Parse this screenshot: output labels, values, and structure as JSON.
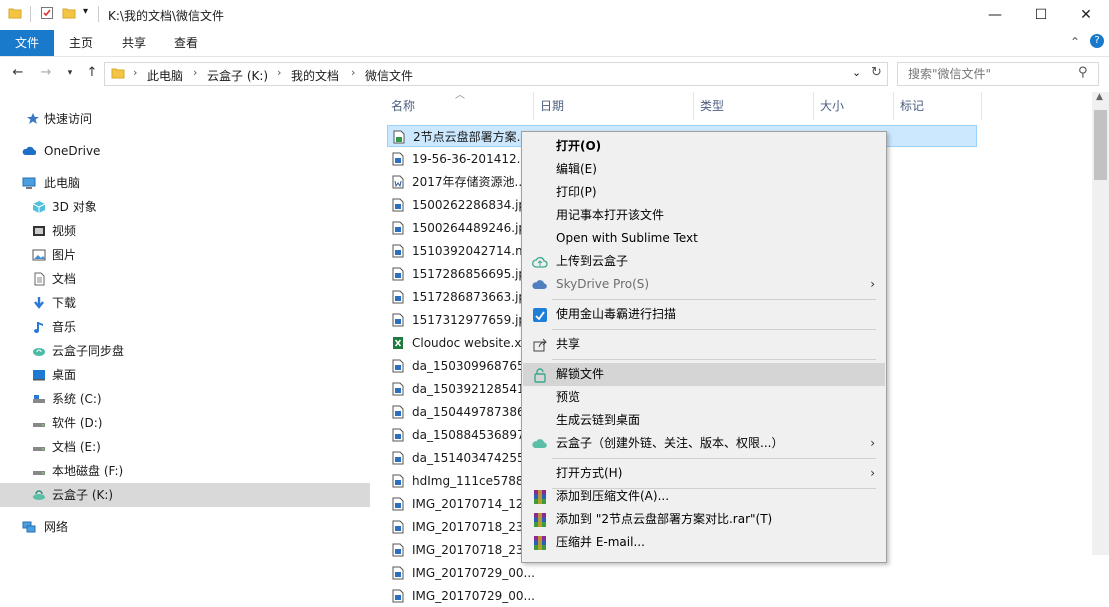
{
  "window": {
    "title": "K:\\我的文档\\微信文件",
    "minimize": "—",
    "maximize": "☐",
    "close": "✕"
  },
  "ribbon": {
    "tabs": [
      "文件",
      "主页",
      "共享",
      "查看"
    ],
    "collapse": "⌃",
    "help": "?"
  },
  "address": {
    "crumbs": [
      "此电脑",
      "云盒子 (K:)",
      "我的文档",
      "微信文件"
    ],
    "search_placeholder": "搜索\"微信文件\""
  },
  "nav": {
    "items": [
      {
        "label": "快速访问",
        "icon": "star-icon"
      },
      {
        "label": "OneDrive",
        "icon": "onedrive-cloud-icon"
      },
      {
        "label": "此电脑",
        "icon": "computer-icon"
      },
      {
        "label": "3D 对象",
        "icon": "3d-objects-icon"
      },
      {
        "label": "视频",
        "icon": "video-icon"
      },
      {
        "label": "图片",
        "icon": "pictures-icon"
      },
      {
        "label": "文档",
        "icon": "documents-icon"
      },
      {
        "label": "下载",
        "icon": "download-icon"
      },
      {
        "label": "音乐",
        "icon": "music-icon"
      },
      {
        "label": "云盒子同步盘",
        "icon": "sync-drive-icon"
      },
      {
        "label": "桌面",
        "icon": "desktop-icon"
      },
      {
        "label": "系统 (C:)",
        "icon": "drive-c-icon"
      },
      {
        "label": "软件 (D:)",
        "icon": "drive-icon"
      },
      {
        "label": "文档 (E:)",
        "icon": "drive-icon"
      },
      {
        "label": "本地磁盘 (F:)",
        "icon": "drive-icon"
      },
      {
        "label": "云盒子 (K:)",
        "icon": "cloud-drive-icon"
      },
      {
        "label": "网络",
        "icon": "network-icon"
      }
    ]
  },
  "columns": [
    "名称",
    "日期",
    "类型",
    "大小",
    "标记"
  ],
  "files": [
    {
      "name": "2节点云盘部署方案...",
      "icon": "locked-doc-icon"
    },
    {
      "name": "19-56-36-201412...",
      "icon": "image-file-icon"
    },
    {
      "name": "2017年存储资源池...",
      "icon": "word-file-icon"
    },
    {
      "name": "1500262286834.jpg",
      "icon": "image-file-icon"
    },
    {
      "name": "1500264489246.jpg",
      "icon": "image-file-icon"
    },
    {
      "name": "1510392042714.m...",
      "icon": "image-file-icon"
    },
    {
      "name": "1517286856695.jpg",
      "icon": "image-file-icon"
    },
    {
      "name": "1517286873663.jpg",
      "icon": "image-file-icon"
    },
    {
      "name": "1517312977659.jpg",
      "icon": "image-file-icon"
    },
    {
      "name": "Cloudoc website.x...",
      "icon": "excel-file-icon"
    },
    {
      "name": "da_150309968765...",
      "icon": "image-file-icon"
    },
    {
      "name": "da_150392128541...",
      "icon": "image-file-icon"
    },
    {
      "name": "da_150449787386...",
      "icon": "image-file-icon"
    },
    {
      "name": "da_150884536897...",
      "icon": "image-file-icon"
    },
    {
      "name": "da_151403474255...",
      "icon": "image-file-icon"
    },
    {
      "name": "hdImg_111ce5788...",
      "icon": "image-file-icon"
    },
    {
      "name": "IMG_20170714_12...",
      "icon": "image-file-icon"
    },
    {
      "name": "IMG_20170718_23...",
      "icon": "image-file-icon"
    },
    {
      "name": "IMG_20170718_23...",
      "icon": "image-file-icon"
    },
    {
      "name": "IMG_20170729_00...",
      "icon": "image-file-icon"
    },
    {
      "name": "IMG_20170729_00...",
      "icon": "image-file-icon"
    }
  ],
  "menu": {
    "open": "打开(O)",
    "edit": "编辑(E)",
    "print": "打印(P)",
    "notepad": "用记事本打开该文件",
    "sublime": "Open with Sublime Text",
    "upload": "上传到云盒子",
    "skydrive": "SkyDrive Pro(S)",
    "scan": "使用金山毒霸进行扫描",
    "share": "共享",
    "unlock": "解锁文件",
    "preview": "预览",
    "cloudlink": "生成云链到桌面",
    "yunhezi": "云盒子（创建外链、关注、版本、权限...）",
    "openwith": "打开方式(H)",
    "addzip": "添加到压缩文件(A)...",
    "addrar": "添加到 \"2节点云盘部署方案对比.rar\"(T)",
    "zipmail": "压缩并 E-mail...",
    "submenu_arrow": "›"
  },
  "colors": {
    "accent": "#1979ca",
    "selection": "#cce8ff",
    "menu_bg": "#f0f0f0"
  }
}
